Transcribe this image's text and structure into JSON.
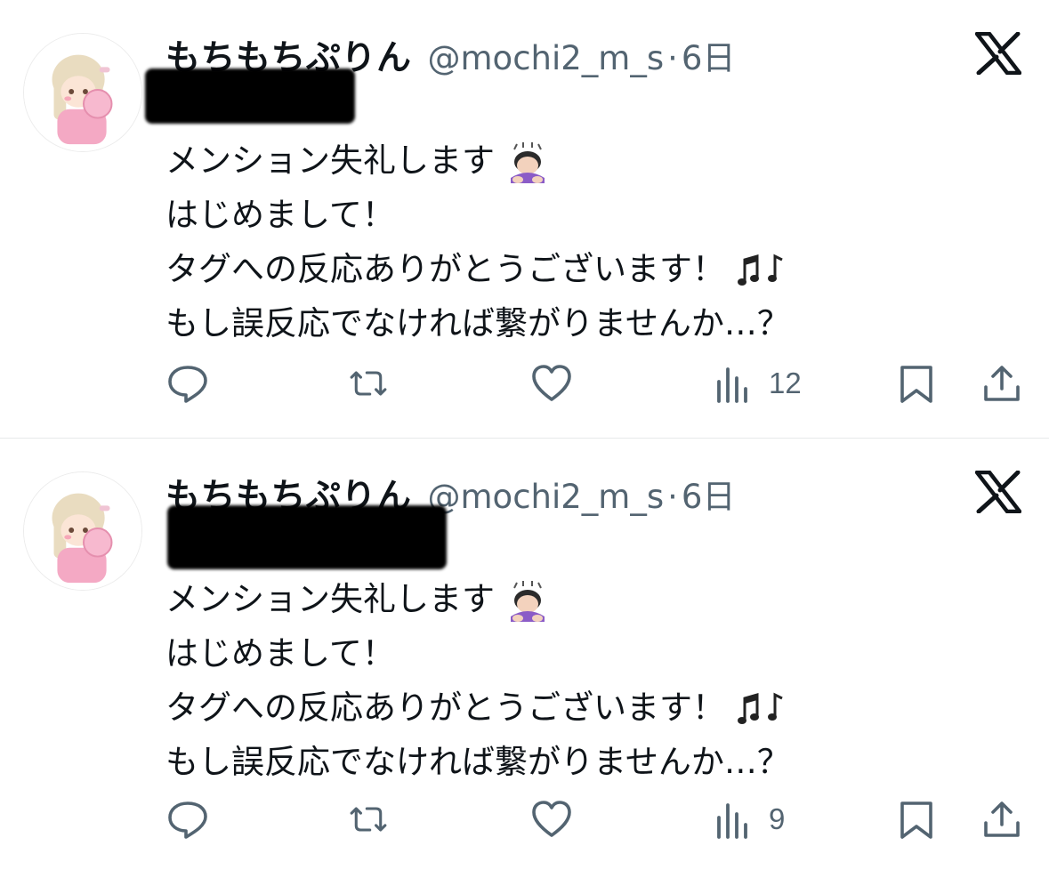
{
  "tweets": [
    {
      "author_name": "もちもちぷりん",
      "handle": "@mochi2_m_s",
      "separator": "·",
      "time": "6日",
      "lines": [
        "メンション失礼します",
        "はじめまして！",
        "タグへの反応ありがとうございます！",
        "もし誤反応でなければ繋がりませんか…？"
      ],
      "line_emojis": [
        "person-bowing-emoji",
        null,
        "musical-notes-emoji",
        null
      ],
      "views": "12"
    },
    {
      "author_name": "もちもちぷりん",
      "handle": "@mochi2_m_s",
      "separator": "·",
      "time": "6日",
      "lines": [
        "メンション失礼します",
        "はじめまして！",
        "タグへの反応ありがとうございます！",
        "もし誤反応でなければ繋がりませんか…？"
      ],
      "line_emojis": [
        "person-bowing-emoji",
        null,
        "musical-notes-emoji",
        null
      ],
      "views": "9"
    }
  ],
  "icons": {
    "brand": "x-logo-icon",
    "reply": "reply-icon",
    "retweet": "retweet-icon",
    "like": "heart-icon",
    "views": "views-chart-icon",
    "bookmark": "bookmark-icon",
    "share": "share-icon"
  },
  "colors": {
    "text": "#0f1419",
    "secondary": "#536471",
    "divider": "#e7e9ea",
    "redaction": "#000000",
    "avatar_pink": "#f4a9c4",
    "avatar_hair": "#e9dcc0"
  }
}
